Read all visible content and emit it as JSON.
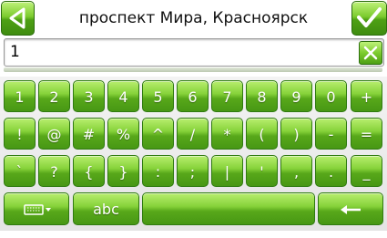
{
  "header": {
    "title": "проспект Мира, Красноярск"
  },
  "input": {
    "value": "1"
  },
  "keyboard": {
    "rows": [
      [
        "1",
        "2",
        "3",
        "4",
        "5",
        "6",
        "7",
        "8",
        "9",
        "0",
        "+"
      ],
      [
        "!",
        "@",
        "#",
        "%",
        "^",
        "/",
        "*",
        "(",
        ")",
        "-",
        "="
      ],
      [
        "`",
        "?",
        "{",
        "}",
        ":",
        ";",
        "|",
        "'",
        ",",
        ".",
        "_"
      ]
    ],
    "bottom": {
      "abc_label": "abc"
    }
  },
  "colors": {
    "key_green": "#58a81a",
    "key_border": "#2f7a10",
    "label": "#ffffff"
  }
}
